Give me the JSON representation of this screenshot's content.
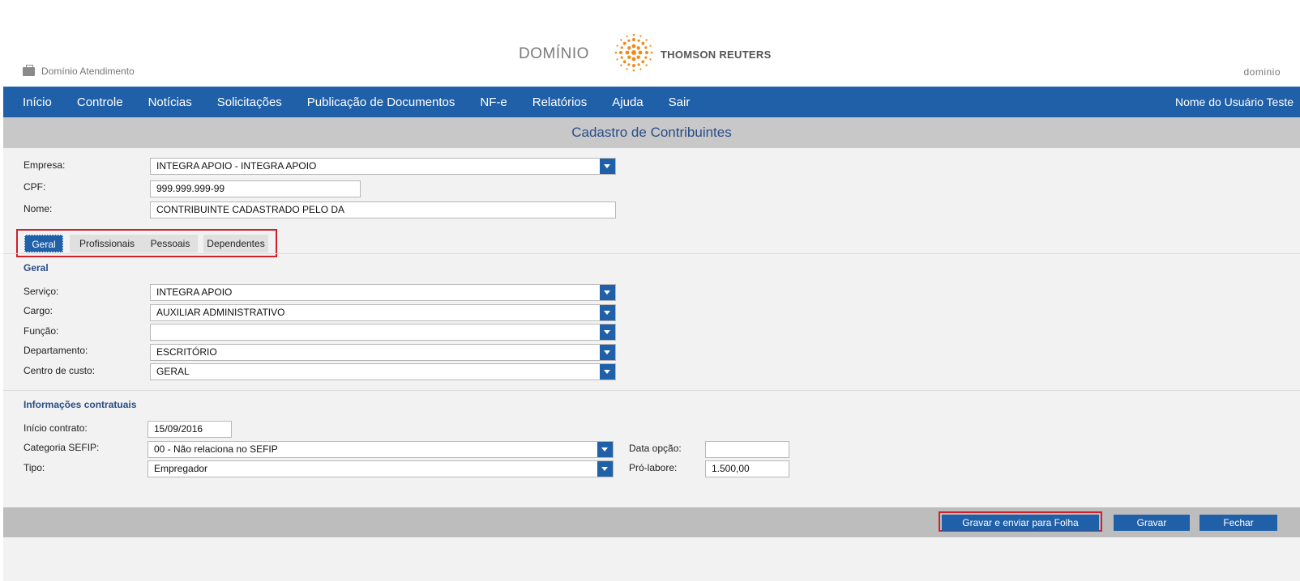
{
  "header": {
    "brand_title": "DOMÍNIO",
    "brand_company": "THOMSON REUTERS",
    "app_name": "Domínio Atendimento",
    "mini_logo": "dominio",
    "brand_color": "#f08a1c"
  },
  "nav": {
    "items": [
      "Início",
      "Controle",
      "Notícias",
      "Solicitações",
      "Publicação de Documentos",
      "NF-e",
      "Relatórios",
      "Ajuda",
      "Sair"
    ],
    "user": "Nome do Usuário Teste",
    "color": "#2060a8"
  },
  "page_title": "Cadastro de Contribuintes",
  "top_form": {
    "empresa_label": "Empresa:",
    "empresa_value": "INTEGRA APOIO - INTEGRA APOIO",
    "cpf_label": "CPF:",
    "cpf_value": "999.999.999-99",
    "nome_label": "Nome:",
    "nome_value": "CONTRIBUINTE CADASTRADO PELO DA"
  },
  "tabs": [
    "Geral",
    "Profissionais",
    "Pessoais",
    "Dependentes"
  ],
  "active_tab": "Geral",
  "geral": {
    "title": "Geral",
    "servico_label": "Serviço:",
    "servico_value": "INTEGRA APOIO",
    "cargo_label": "Cargo:",
    "cargo_value": "AUXILIAR ADMINISTRATIVO",
    "funcao_label": "Função:",
    "funcao_value": "",
    "departamento_label": "Departamento:",
    "departamento_value": "ESCRITÓRIO",
    "centro_label": "Centro de custo:",
    "centro_value": "GERAL"
  },
  "contrato": {
    "title": "Informações contratuais",
    "inicio_label": "Início contrato:",
    "inicio_value": "15/09/2016",
    "categoria_label": "Categoria SEFIP:",
    "categoria_value": "00 - Não relaciona no SEFIP",
    "tipo_label": "Tipo:",
    "tipo_value": "Empregador",
    "data_opcao_label": "Data opção:",
    "data_opcao_value": "",
    "pro_labore_label": "Pró-labore:",
    "pro_labore_value": "1.500,00"
  },
  "buttons": {
    "gravar_enviar": "Gravar e enviar para Folha",
    "gravar": "Gravar",
    "fechar": "Fechar"
  },
  "highlight_color": "#d0202c"
}
